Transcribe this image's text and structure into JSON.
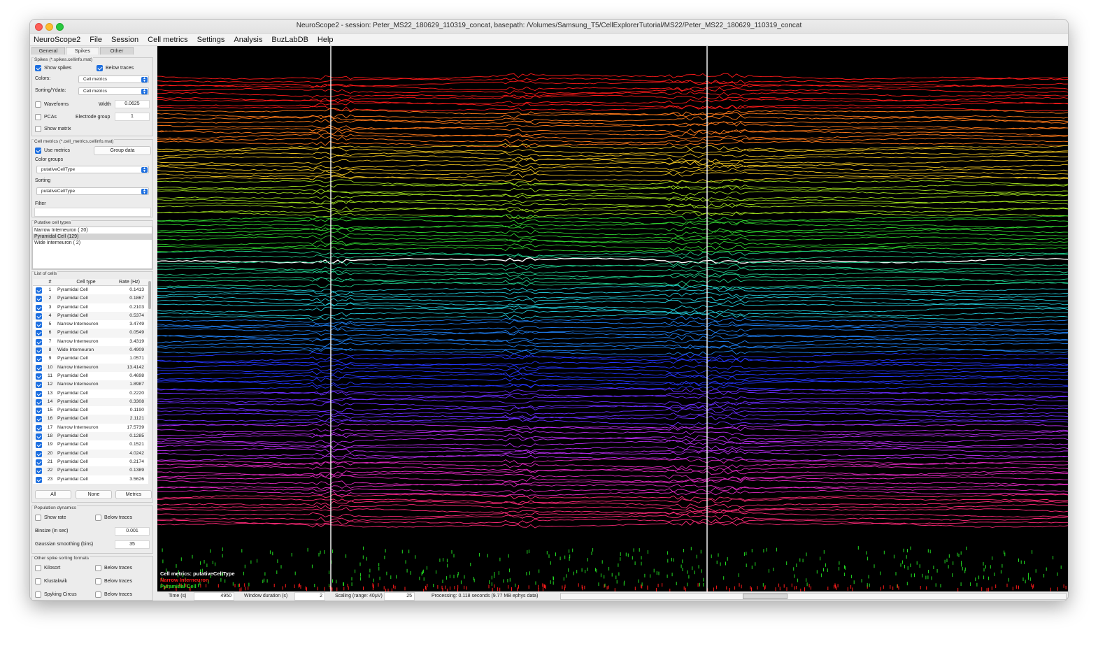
{
  "window": {
    "title": "NeuroScope2  -  session: Peter_MS22_180629_110319_concat, basepath: /Volumes/Samsung_T5/CellExplorerTutorial/MS22/Peter_MS22_180629_110319_concat"
  },
  "menu": [
    "NeuroScope2",
    "File",
    "Session",
    "Cell metrics",
    "Settings",
    "Analysis",
    "BuzLabDB",
    "Help"
  ],
  "tabs": [
    "General",
    "Spikes",
    "Other"
  ],
  "spikes_panel": {
    "title": "Spikes (*.spikes.cellinfo.mat)",
    "show_spikes": "Show spikes",
    "below_traces": "Below traces",
    "colors_label": "Colors:",
    "colors_value": "Cell metrics",
    "sorting_label": "Sorting/Ydata:",
    "sorting_value": "Cell metrics",
    "waveforms": "Waveforms",
    "width_label": "Width",
    "width_value": "0.0625",
    "pcas": "PCAs",
    "electrode_group_label": "Electrode group",
    "electrode_group_value": "1",
    "show_matrix": "Show matrix"
  },
  "cell_metrics_panel": {
    "title": "Cell metrics (*.cell_metrics.cellinfo.mat)",
    "use_metrics": "Use metrics",
    "group_data": "Group data",
    "color_groups_label": "Color groups",
    "color_groups_value": "putativeCellType",
    "sorting_label": "Sorting",
    "sorting_value": "putativeCellType",
    "filter_label": "Filter"
  },
  "putative_types": {
    "title": "Putative cell types",
    "items": [
      "Narrow Interneuron ( 20)",
      "Pyramidal Cell (129)",
      "Wide Interneuron (  2)"
    ]
  },
  "cell_list": {
    "title": "List of cells",
    "headers": [
      "#",
      "Cell type",
      "Rate (Hz)"
    ],
    "rows": [
      {
        "n": "1",
        "type": "Pyramidal Cell",
        "rate": "0.1413"
      },
      {
        "n": "2",
        "type": "Pyramidal Cell",
        "rate": "0.1867"
      },
      {
        "n": "3",
        "type": "Pyramidal Cell",
        "rate": "0.2103"
      },
      {
        "n": "4",
        "type": "Pyramidal Cell",
        "rate": "0.5374"
      },
      {
        "n": "5",
        "type": "Narrow Interneuron",
        "rate": "3.4749"
      },
      {
        "n": "6",
        "type": "Pyramidal Cell",
        "rate": "0.0549"
      },
      {
        "n": "7",
        "type": "Narrow Interneuron",
        "rate": "3.4319"
      },
      {
        "n": "8",
        "type": "Wide Interneuron",
        "rate": "0.4909"
      },
      {
        "n": "9",
        "type": "Pyramidal Cell",
        "rate": "1.0571"
      },
      {
        "n": "10",
        "type": "Narrow Interneuron",
        "rate": "13.4142"
      },
      {
        "n": "11",
        "type": "Pyramidal Cell",
        "rate": "0.4698"
      },
      {
        "n": "12",
        "type": "Narrow Interneuron",
        "rate": "1.8987"
      },
      {
        "n": "13",
        "type": "Pyramidal Cell",
        "rate": "0.2220"
      },
      {
        "n": "14",
        "type": "Pyramidal Cell",
        "rate": "0.3308"
      },
      {
        "n": "15",
        "type": "Pyramidal Cell",
        "rate": "0.1190"
      },
      {
        "n": "16",
        "type": "Pyramidal Cell",
        "rate": "2.1121"
      },
      {
        "n": "17",
        "type": "Narrow Interneuron",
        "rate": "17.5739"
      },
      {
        "n": "18",
        "type": "Pyramidal Cell",
        "rate": "0.1285"
      },
      {
        "n": "19",
        "type": "Pyramidal Cell",
        "rate": "0.1521"
      },
      {
        "n": "20",
        "type": "Pyramidal Cell",
        "rate": "4.0242"
      },
      {
        "n": "21",
        "type": "Pyramidal Cell",
        "rate": "0.2174"
      },
      {
        "n": "22",
        "type": "Pyramidal Cell",
        "rate": "0.1389"
      },
      {
        "n": "23",
        "type": "Pyramidal Cell",
        "rate": "3.5626"
      }
    ],
    "btn_all": "All",
    "btn_none": "None",
    "btn_metrics": "Metrics"
  },
  "population_panel": {
    "title": "Population dynamics",
    "show_rate": "Show rate",
    "below_traces": "Below traces",
    "binsize_label": "Binsize (in sec)",
    "binsize_value": "0.001",
    "gauss_label": "Gaussian smoothing (bins)",
    "gauss_value": "35"
  },
  "other_sorting_panel": {
    "title": "Other spike sorting formats",
    "kilosort": "Kilosort",
    "klustakwik": "Klustakwik",
    "spyking_circus": "Spyking Circus",
    "below_traces": "Below traces"
  },
  "plot": {
    "legend_title": "Cell metrics: putativeCellType",
    "legend_items": [
      {
        "label": "Narrow Interneuron",
        "color": "#ff1a1a"
      },
      {
        "label": "Pyramidal Cell",
        "color": "#22dd22"
      }
    ]
  },
  "status": {
    "time_label": "Time (s)",
    "time_value": "4950",
    "window_label": "Window duration (s)",
    "window_value": "2",
    "scaling_label": "Scaling (range: 40μV)",
    "scaling_value": "25",
    "processing": "Processing: 0.118 seconds (9.77 MB ephys data)",
    "slider_position": 0.36
  },
  "colors": {
    "accent": "#1d6fe0",
    "plot_bg": "#000000",
    "trace_band_colors": [
      "#ff1a1a",
      "#ff7a1a",
      "#e8c020",
      "#9ddc1e",
      "#2fcf2f",
      "#1fc98a",
      "#22c8d6",
      "#1e7df0",
      "#2536ff",
      "#6a2cff",
      "#b62cf0",
      "#e028c0",
      "#ff2a78"
    ]
  }
}
